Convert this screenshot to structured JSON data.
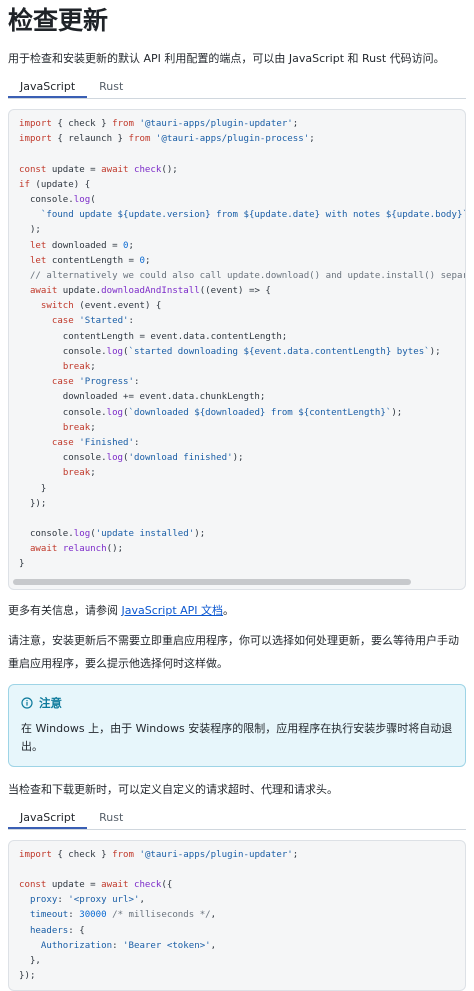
{
  "title": "检查更新",
  "intro": "用于检查和安装更新的默认 API 利用配置的端点，可以由 JavaScript 和 Rust 代码访问。",
  "tabs1": [
    "JavaScript",
    "Rust"
  ],
  "code1": [
    "import { check } from '@tauri-apps/plugin-updater';",
    "import { relaunch } from '@tauri-apps/plugin-process';",
    "",
    "const update = await check();",
    "if (update) {",
    "  console.log(",
    "    `found update ${update.version} from ${update.date} with notes ${update.body}`",
    "  );",
    "  let downloaded = 0;",
    "  let contentLength = 0;",
    "  // alternatively we could also call update.download() and update.install() separately",
    "  await update.downloadAndInstall((event) => {",
    "    switch (event.event) {",
    "      case 'Started':",
    "        contentLength = event.data.contentLength;",
    "        console.log(`started downloading ${event.data.contentLength} bytes`);",
    "        break;",
    "      case 'Progress':",
    "        downloaded += event.data.chunkLength;",
    "        console.log(`downloaded ${downloaded} from ${contentLength}`);",
    "        break;",
    "      case 'Finished':",
    "        console.log('download finished');",
    "        break;",
    "    }",
    "  });",
    "",
    "  console.log('update installed');",
    "  await relaunch();",
    "}"
  ],
  "more_info_prefix": "更多有关信息，请参阅 ",
  "more_info_link": "JavaScript API 文档",
  "more_info_suffix": "。",
  "caution": "请注意，安装更新后不需要立即重启应用程序，你可以选择如何处理更新，要么等待用户手动重启应用程序，要么提示他选择何时这样做。",
  "note": {
    "title": "注意",
    "body": "在 Windows 上，由于 Windows 安装程序的限制，应用程序在执行安装步骤时将自动退出。"
  },
  "custom_intro": "当检查和下载更新时，可以定义自定义的请求超时、代理和请求头。",
  "tabs2": [
    "JavaScript",
    "Rust"
  ],
  "code2": [
    "import { check } from '@tauri-apps/plugin-updater';",
    "",
    "const update = await check({",
    "  proxy: '<proxy url>',",
    "  timeout: 30000 /* milliseconds */,",
    "  headers: {",
    "    Authorization: 'Bearer <token>',",
    "  },",
    "});"
  ],
  "colors": {
    "accent": "#3a5fb4",
    "link": "#0b57d0",
    "note_bg": "#e7f6fb",
    "note_title": "#0d7a9c"
  }
}
